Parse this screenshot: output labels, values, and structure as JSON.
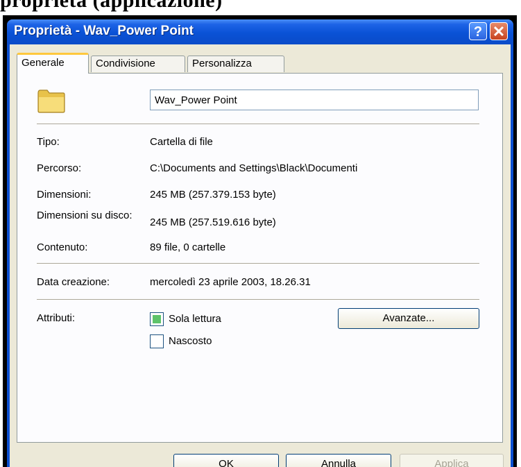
{
  "window": {
    "title": "Proprietà - Wav_Power Point",
    "help_glyph": "?",
    "close_glyph": "✕"
  },
  "tabs": [
    {
      "label": "Generale",
      "active": true
    },
    {
      "label": "Condivisione",
      "active": false
    },
    {
      "label": "Personalizza",
      "active": false
    }
  ],
  "icons": {
    "folder": "folder-icon"
  },
  "folder_name": "Wav_Power Point",
  "properties": [
    {
      "label": "Tipo:",
      "value": "Cartella di file"
    },
    {
      "label": "Percorso:",
      "value": "C:\\Documents and Settings\\Black\\Documenti"
    },
    {
      "label": "Dimensioni:",
      "value": "245 MB (257.379.153 byte)"
    },
    {
      "label": "Dimensioni su disco:",
      "value": "245 MB (257.519.616 byte)"
    },
    {
      "label": "Contenuto:",
      "value": "89 file, 0 cartelle"
    }
  ],
  "created": {
    "label": "Data creazione:",
    "value": "mercoledì 23 aprile 2003, 18.26.31"
  },
  "attributes": {
    "label": "Attributi:",
    "read_only": {
      "label": "Sola lettura",
      "checked": true
    },
    "hidden": {
      "label": "Nascosto",
      "checked": false
    },
    "advanced_button": "Avanzate..."
  },
  "buttons": {
    "ok": "OK",
    "cancel": "Annulla",
    "apply": "Applica"
  },
  "colors": {
    "titlebar": "#0a52d6",
    "client_bg": "#ece9d8",
    "tab_highlight": "#ffc83c",
    "checkbox_fill": "#5ec36a"
  }
}
